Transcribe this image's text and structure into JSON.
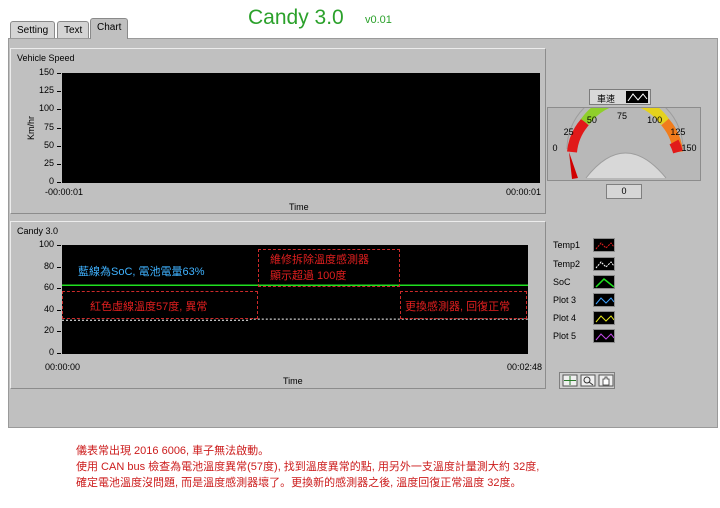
{
  "app": {
    "title": "Candy 3.0",
    "version": "v0.01"
  },
  "tabs": [
    {
      "label": "Setting",
      "active": false
    },
    {
      "label": "Text",
      "active": false
    },
    {
      "label": "Chart",
      "active": true
    }
  ],
  "vehicle_speed": {
    "group_label": "Vehicle Speed",
    "ylabel": "Km/hr",
    "xlabel": "Time",
    "x_start": "-00:00:01",
    "x_end": "00:00:01",
    "y_ticks": [
      "150",
      "125",
      "100",
      "75",
      "50",
      "25",
      "0"
    ],
    "legend_label": "車速"
  },
  "gauge": {
    "ticks": [
      "0",
      "25",
      "50",
      "75",
      "100",
      "125",
      "150"
    ],
    "value": 0,
    "readout": "0"
  },
  "candy_chart": {
    "group_label": "Candy 3.0",
    "xlabel": "Time",
    "x_start": "00:00:00",
    "x_end": "00:02:48",
    "y_ticks": [
      "100",
      "80",
      "60",
      "40",
      "20",
      "0"
    ],
    "legend": [
      "Temp1",
      "Temp2",
      "SoC",
      "Plot 3",
      "Plot 4",
      "Plot 5"
    ],
    "annotations": {
      "soc_note": "藍線為SoC, 電池電量63%",
      "temp_note": "紅色虛線溫度57度, 異常",
      "sensor_removed_line1": "維修拆除溫度感測器",
      "sensor_removed_line2": "顯示超過 100度",
      "sensor_replaced": "更換感測器, 回復正常"
    }
  },
  "chart_data": {
    "type": "line",
    "title": "Candy 3.0",
    "xlabel": "Time",
    "ylabel": "",
    "x": [
      "00:00:00",
      "00:01:07",
      "00:01:08",
      "00:02:48"
    ],
    "ylim": [
      0,
      100
    ],
    "series": [
      {
        "name": "SoC",
        "color": "#20e020",
        "values": [
          63,
          63,
          63,
          63
        ]
      },
      {
        "name": "Temp2",
        "color": "#ffffff",
        "values": [
          31,
          31,
          32,
          32
        ]
      }
    ]
  },
  "notes": [
    "儀表常出現 2016 6006, 車子無法啟動。",
    "使用 CAN bus 檢查為電池溫度異常(57度), 找到溫度異常的點, 用另外一支溫度計量測大約 32度,",
    "確定電池溫度沒問題, 而是溫度感測器壞了。更換新的感測器之後, 溫度回復正常溫度 32度。"
  ]
}
